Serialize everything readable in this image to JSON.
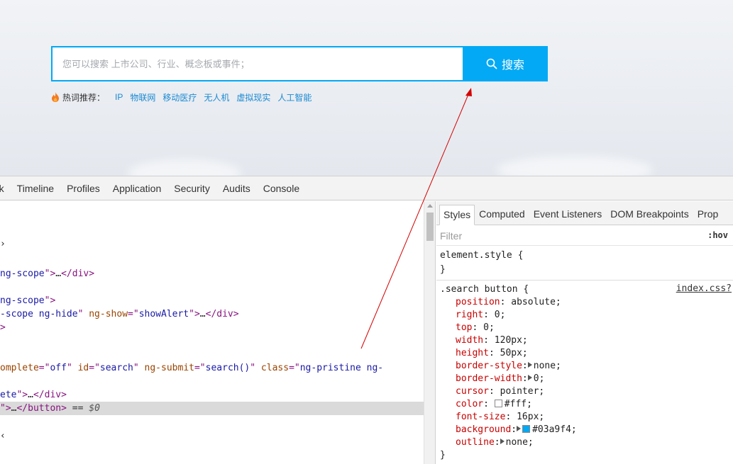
{
  "search": {
    "placeholder": "您可以搜索 上市公司、行业、概念板或事件；",
    "button_label": "搜索"
  },
  "hot": {
    "label": "热词推荐：",
    "items": [
      "IP",
      "物联网",
      "移动医疗",
      "无人机",
      "虚拟现实",
      "人工智能"
    ]
  },
  "devtools": {
    "tabs": [
      "rk",
      "Timeline",
      "Profiles",
      "Application",
      "Security",
      "Audits",
      "Console"
    ],
    "elements_lines": [
      {
        "parts": [
          {
            "c": "tx",
            "t": "›"
          }
        ]
      },
      {
        "parts": [
          {
            "c": "av",
            "t": "ng-scope"
          },
          {
            "c": "t",
            "t": "\">"
          },
          {
            "c": "tx",
            "t": "…"
          },
          {
            "c": "t",
            "t": "</div>"
          }
        ]
      },
      {
        "parts": [
          {
            "c": "av",
            "t": "ng-scope"
          },
          {
            "c": "t",
            "t": "\">"
          }
        ]
      },
      {
        "parts": [
          {
            "c": "av",
            "t": "-scope ng-hide"
          },
          {
            "c": "t",
            "t": "\" "
          },
          {
            "c": "an",
            "t": "ng-show"
          },
          {
            "c": "t",
            "t": "=\""
          },
          {
            "c": "av",
            "t": "showAlert"
          },
          {
            "c": "t",
            "t": "\">"
          },
          {
            "c": "tx",
            "t": "…"
          },
          {
            "c": "t",
            "t": "</div>"
          }
        ]
      },
      {
        "parts": [
          {
            "c": "t",
            "t": ">"
          }
        ]
      },
      {
        "parts": [
          {
            "c": "an",
            "t": "omplete"
          },
          {
            "c": "t",
            "t": "=\""
          },
          {
            "c": "av",
            "t": "off"
          },
          {
            "c": "t",
            "t": "\" "
          },
          {
            "c": "an",
            "t": "id"
          },
          {
            "c": "t",
            "t": "=\""
          },
          {
            "c": "av",
            "t": "search"
          },
          {
            "c": "t",
            "t": "\" "
          },
          {
            "c": "an",
            "t": "ng-submit"
          },
          {
            "c": "t",
            "t": "=\""
          },
          {
            "c": "av",
            "t": "search()"
          },
          {
            "c": "t",
            "t": "\" "
          },
          {
            "c": "an",
            "t": "class"
          },
          {
            "c": "t",
            "t": "=\""
          },
          {
            "c": "av",
            "t": "ng-pristine ng-"
          }
        ]
      },
      {
        "parts": [
          {
            "c": "av",
            "t": "ete"
          },
          {
            "c": "t",
            "t": "\">"
          },
          {
            "c": "tx",
            "t": "…"
          },
          {
            "c": "t",
            "t": "</div>"
          }
        ]
      },
      {
        "parts": [
          {
            "c": "t",
            "t": "\">"
          },
          {
            "c": "tx",
            "t": "…"
          },
          {
            "c": "t",
            "t": "</button>"
          },
          {
            "c": "sel-eq",
            "t": " == "
          },
          {
            "c": "sel-dollar",
            "t": "$0"
          }
        ]
      },
      {
        "parts": [
          {
            "c": "tx",
            "t": "‹"
          }
        ]
      }
    ]
  },
  "styles": {
    "tabs": [
      "Styles",
      "Computed",
      "Event Listeners",
      "DOM Breakpoints",
      "Prop"
    ],
    "filter_placeholder": "Filter",
    "hov_label": ":hov",
    "element_style": {
      "open": "element.style {",
      "close": "}"
    },
    "rule": {
      "selector": ".search button {",
      "source": "index.css?",
      "props": [
        {
          "name": "position",
          "value": "absolute;"
        },
        {
          "name": "right",
          "value": "0;"
        },
        {
          "name": "top",
          "value": "0;"
        },
        {
          "name": "width",
          "value": "120px;"
        },
        {
          "name": "height",
          "value": "50px;"
        },
        {
          "name": "border-style",
          "value": "none;"
        },
        {
          "name": "border-width",
          "value": "0;"
        },
        {
          "name": "cursor",
          "value": "pointer;"
        },
        {
          "name": "color",
          "value": "#fff;"
        },
        {
          "name": "font-size",
          "value": "16px;"
        },
        {
          "name": "background",
          "value": "#03a9f4;"
        },
        {
          "name": "outline",
          "value": "none;"
        }
      ],
      "close": "}"
    }
  },
  "colors": {
    "accent": "#03a9f4",
    "link": "#1b8ad3",
    "annotation_arrow": "#d40000",
    "swatch_white": "#ffffff",
    "swatch_blue": "#03a9f4"
  }
}
